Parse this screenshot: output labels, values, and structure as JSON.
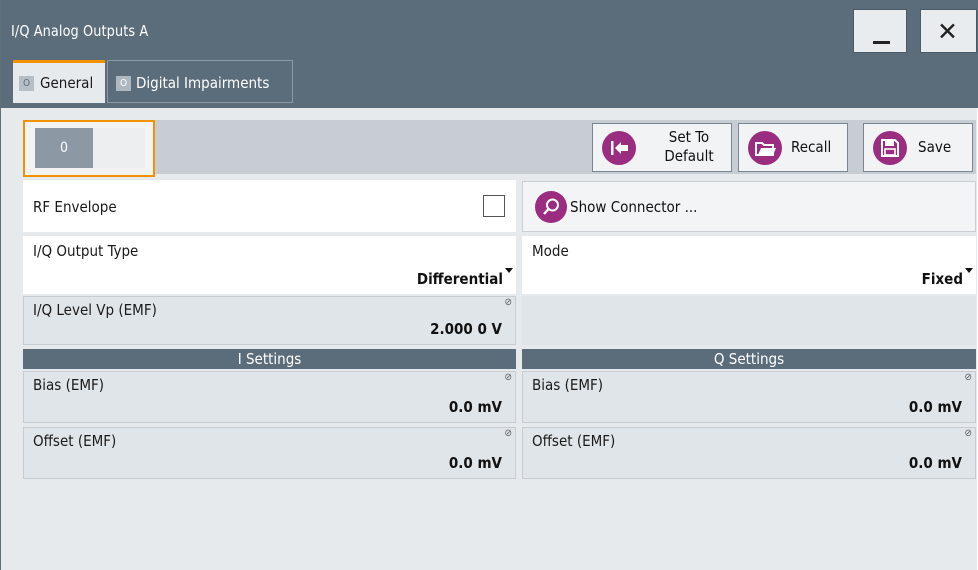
{
  "window": {
    "title": "I/Q Analog Outputs A",
    "minimize_icon": "minimize-icon",
    "close_icon": "close-icon",
    "close_glyph": "✕"
  },
  "tabs": [
    {
      "label": "General",
      "indicator": "O",
      "active": true
    },
    {
      "label": "Digital Impairments",
      "indicator": "O",
      "active": false
    }
  ],
  "toolbar": {
    "state_label": "0",
    "set_default_line1": "Set To",
    "set_default_line2": "Default",
    "recall_label": "Recall",
    "save_label": "Save"
  },
  "fields": {
    "rf_envelope": {
      "label": "RF Envelope",
      "checked": false
    },
    "show_connector_label": "Show Connector ...",
    "iq_output_type": {
      "label": "I/Q Output Type",
      "value": "Differential"
    },
    "mode": {
      "label": "Mode",
      "value": "Fixed"
    },
    "iq_level": {
      "label": "I/Q Level Vp (EMF)",
      "value": "2.000 0 V"
    }
  },
  "i_settings": {
    "header": "I Settings",
    "bias": {
      "label": "Bias (EMF)",
      "value": "0.0 mV"
    },
    "offset": {
      "label": "Offset (EMF)",
      "value": "0.0 mV"
    }
  },
  "q_settings": {
    "header": "Q Settings",
    "bias": {
      "label": "Bias (EMF)",
      "value": "0.0 mV"
    },
    "offset": {
      "label": "Offset (EMF)",
      "value": "0.0 mV"
    }
  },
  "colors": {
    "titlebar": "#5b6c7a",
    "accent_orange": "#f29200",
    "button_purple": "#9a2d7f"
  }
}
